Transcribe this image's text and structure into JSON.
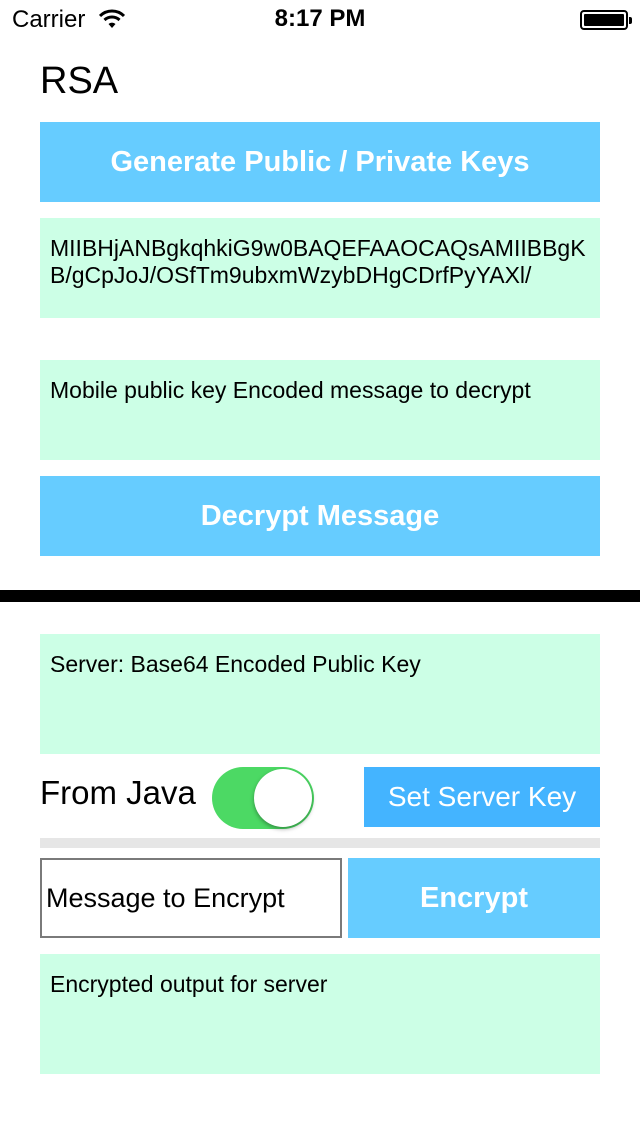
{
  "status_bar": {
    "carrier": "Carrier",
    "time": "8:17 PM",
    "wifi_icon": "wifi-icon",
    "battery_icon": "battery-icon"
  },
  "title": "RSA",
  "generate_button": "Generate Public / Private Keys",
  "public_key_text": "MIIBHjANBgkqhkiG9w0BAQEFAAOCAQsAMIIBBgKB/gCpJoJ/OSfTm9ubxmWzybDHgCDrfPyYAXl/",
  "decrypt_input_placeholder": "Mobile public key Encoded message to decrypt",
  "decrypt_button": "Decrypt Message",
  "server_key_placeholder": "Server: Base64 Encoded Public Key",
  "from_java_label": "From Java",
  "from_java_toggle_on": true,
  "set_server_key_button": "Set Server Key",
  "message_placeholder": "Message to Encrypt",
  "encrypt_button": "Encrypt",
  "encrypted_output_placeholder": "Encrypted output for server",
  "colors": {
    "button": "#66ccff",
    "button_dark": "#44b4ff",
    "field": "#ccffe6",
    "toggle_on": "#4cd964"
  }
}
